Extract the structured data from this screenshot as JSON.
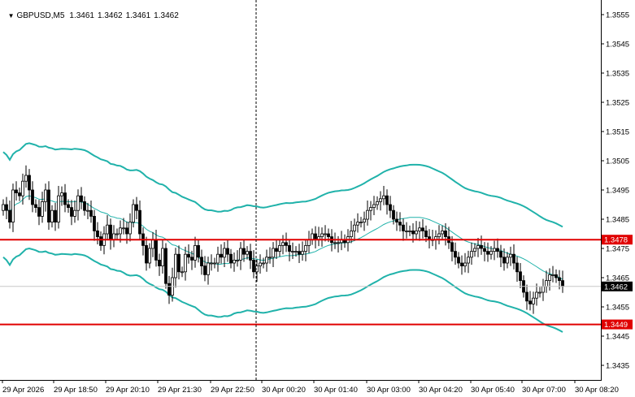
{
  "header": {
    "symbol": "GBPUSD,M5",
    "quotes": [
      "1.3461",
      "1.3462",
      "1.3461",
      "1.3462"
    ]
  },
  "chart_data": {
    "type": "candlestick",
    "symbol": "GBPUSD",
    "timeframe": "M5",
    "ylim": [
      1.343,
      1.356
    ],
    "y_ticks": [
      "1.3555",
      "1.3545",
      "1.3535",
      "1.3525",
      "1.3515",
      "1.3505",
      "1.3495",
      "1.3485",
      "1.3475",
      "1.3465",
      "1.3455",
      "1.3445",
      "1.3435"
    ],
    "x_ticks": [
      "29 Apr 2026",
      "29 Apr 18:50",
      "29 Apr 20:10",
      "29 Apr 21:30",
      "29 Apr 22:50",
      "30 Apr 00:20",
      "30 Apr 01:40",
      "30 Apr 03:00",
      "30 Apr 04:20",
      "30 Apr 05:40",
      "30 Apr 07:00",
      "30 Apr 08:20"
    ],
    "horizontal_lines": [
      {
        "value": 1.3478,
        "label": "1.3478",
        "color": "#e00000"
      },
      {
        "value": 1.3449,
        "label": "1.3449",
        "color": "#e00000"
      }
    ],
    "current_price": {
      "value": 1.3462,
      "label": "1.3462"
    },
    "vertical_marker_index": 78,
    "close": [
      1.349,
      1.3488,
      1.3484,
      1.3495,
      1.3494,
      1.3493,
      1.3498,
      1.35,
      1.3495,
      1.349,
      1.3489,
      1.3486,
      1.3491,
      1.3495,
      1.3484,
      1.3488,
      1.3484,
      1.3493,
      1.3494,
      1.349,
      1.3489,
      1.3486,
      1.3488,
      1.3493,
      1.3491,
      1.3488,
      1.3488,
      1.3486,
      1.3481,
      1.3479,
      1.3476,
      1.348,
      1.3483,
      1.3478,
      1.348,
      1.348,
      1.3482,
      1.3482,
      1.348,
      1.3484,
      1.349,
      1.3488,
      1.348,
      1.3476,
      1.347,
      1.3475,
      1.3478,
      1.3471,
      1.3469,
      1.3475,
      1.3463,
      1.3459,
      1.3465,
      1.3473,
      1.3467,
      1.3467,
      1.3473,
      1.3472,
      1.3471,
      1.3476,
      1.3472,
      1.3469,
      1.3466,
      1.347,
      1.347,
      1.347,
      1.3473,
      1.3472,
      1.3475,
      1.3473,
      1.347,
      1.3471,
      1.3471,
      1.3475,
      1.3473,
      1.3474,
      1.3471,
      1.3467,
      1.3469,
      1.347,
      1.347,
      1.3472,
      1.3472,
      1.3475,
      1.3474,
      1.3476,
      1.3477,
      1.3476,
      1.3474,
      1.3474,
      1.3474,
      1.3473,
      1.3474,
      1.3476,
      1.3478,
      1.348,
      1.3478,
      1.3479,
      1.348,
      1.348,
      1.3479,
      1.3477,
      1.3477,
      1.3477,
      1.3478,
      1.3477,
      1.3479,
      1.3481,
      1.3483,
      1.3484,
      1.3484,
      1.3485,
      1.3488,
      1.3489,
      1.349,
      1.3491,
      1.3492,
      1.3493,
      1.349,
      1.3488,
      1.3485,
      1.3484,
      1.3483,
      1.3481,
      1.3481,
      1.3481,
      1.348,
      1.3481,
      1.3482,
      1.3481,
      1.3479,
      1.3478,
      1.3478,
      1.3479,
      1.348,
      1.3481,
      1.3479,
      1.3477,
      1.3474,
      1.3472,
      1.347,
      1.3469,
      1.347,
      1.3472,
      1.3474,
      1.3475,
      1.3476,
      1.3475,
      1.3474,
      1.3473,
      1.3474,
      1.3475,
      1.3474,
      1.3472,
      1.347,
      1.3472,
      1.3473,
      1.347,
      1.3467,
      1.3464,
      1.346,
      1.3457,
      1.3456,
      1.3458,
      1.346,
      1.346,
      1.3462,
      1.3464,
      1.3466,
      1.3466,
      1.3465,
      1.3464,
      1.3462
    ]
  }
}
